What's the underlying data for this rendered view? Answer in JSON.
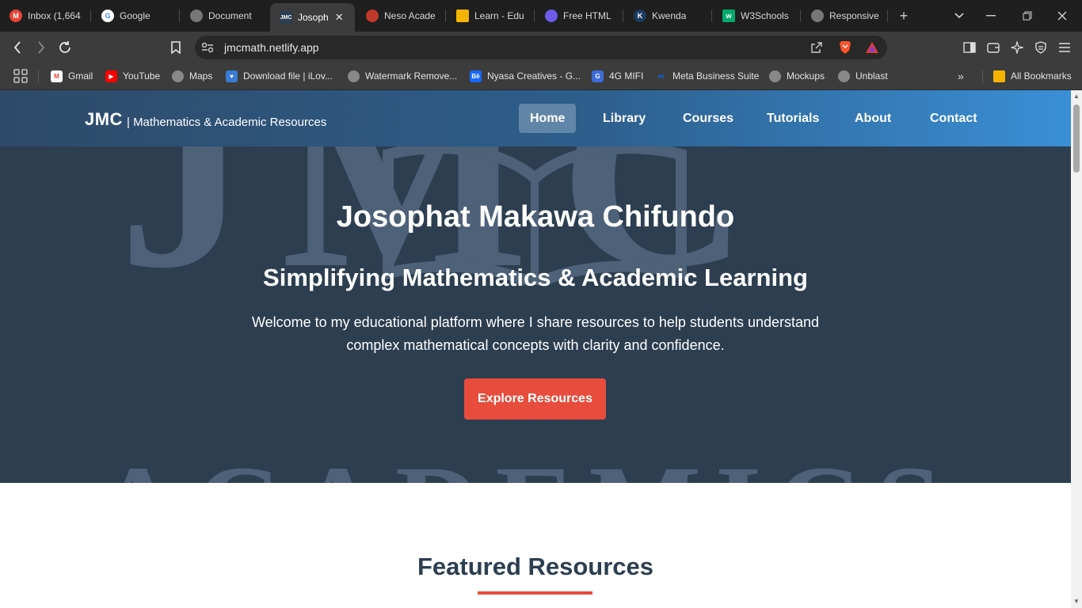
{
  "browser": {
    "tabs": [
      {
        "title": "Inbox (1,664",
        "icon": "gmail-icon",
        "color": "#ea4335"
      },
      {
        "title": "Google",
        "icon": "google-icon",
        "color": "#4285f4"
      },
      {
        "title": "Document",
        "icon": "globe-icon",
        "color": "#777777"
      },
      {
        "title": "Josoph",
        "icon": "jmc-icon",
        "color": "#2c3e50"
      },
      {
        "title": "Neso Acade",
        "icon": "neso-icon",
        "color": "#c0392b"
      },
      {
        "title": "Learn - Edu",
        "icon": "learn-icon",
        "color": "#f5b400"
      },
      {
        "title": "Free HTML",
        "icon": "html-icon",
        "color": "#6c5ce7"
      },
      {
        "title": "Kwenda",
        "icon": "kwenda-icon",
        "color": "#1f3a5f"
      },
      {
        "title": "W3Schools",
        "icon": "w3schools-icon",
        "color": "#04aa6d"
      },
      {
        "title": "Responsive",
        "icon": "globe-icon",
        "color": "#777777"
      }
    ],
    "url": "jmcmath.netlify.app",
    "bookmarks": [
      {
        "label": "Gmail",
        "icon": "gmail-icon",
        "color": "#ea4335"
      },
      {
        "label": "YouTube",
        "icon": "youtube-icon",
        "color": "#ff0000"
      },
      {
        "label": "Maps",
        "icon": "globe-icon",
        "color": "#888888"
      },
      {
        "label": "Download file | iLov...",
        "icon": "heart-icon",
        "color": "#3a7bd5"
      },
      {
        "label": "Watermark Remove...",
        "icon": "globe-icon",
        "color": "#888888"
      },
      {
        "label": "Nyasa Creatives - G...",
        "icon": "behance-icon",
        "color": "#1769ff"
      },
      {
        "label": "4G MIFI",
        "icon": "router-icon",
        "color": "#3d6bd8"
      },
      {
        "label": "Meta Business Suite",
        "icon": "meta-icon",
        "color": "#0668e1"
      },
      {
        "label": "Mockups",
        "icon": "globe-icon",
        "color": "#888888"
      },
      {
        "label": "Unblast",
        "icon": "globe-icon",
        "color": "#888888"
      }
    ],
    "all_bookmarks": "All Bookmarks"
  },
  "site": {
    "logo": "JMC",
    "logo_sub": "| Mathematics & Academic Resources",
    "nav": [
      "Home",
      "Library",
      "Courses",
      "Tutorials",
      "About",
      "Contact"
    ],
    "hero": {
      "title": "Josophat Makawa Chifundo",
      "subtitle": "Simplifying Mathematics & Academic Learning",
      "text": "Welcome to my educational platform where I share resources to help students understand complex mathematical concepts with clarity and confidence.",
      "button": "Explore Resources",
      "watermark_top": "JMC",
      "watermark_bottom": "ACADEMICS"
    },
    "featured_title": "Featured Resources"
  },
  "colors": {
    "header_start": "#2e4a68",
    "header_end": "#3a8fd6",
    "hero_bg": "#2c3e50",
    "accent": "#e74c3c"
  }
}
